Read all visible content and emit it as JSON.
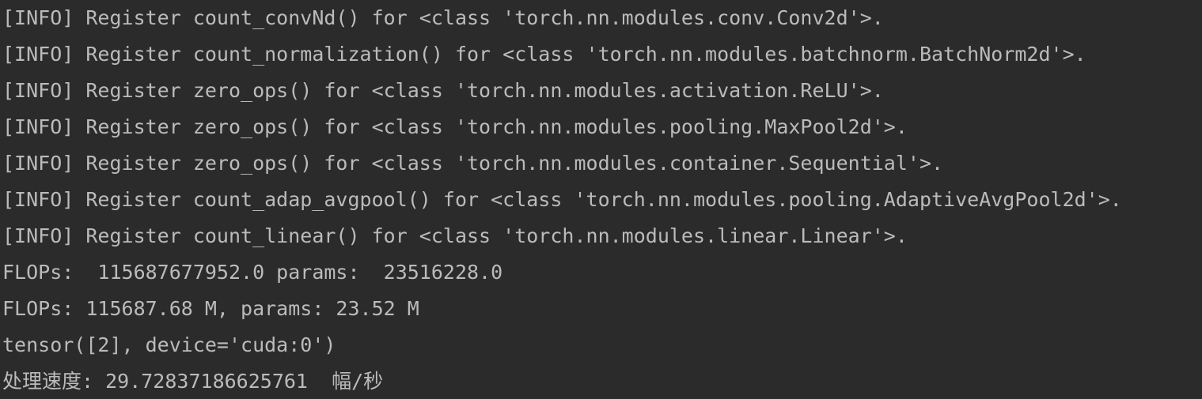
{
  "console": {
    "lines": [
      "[INFO] Register count_convNd() for <class 'torch.nn.modules.conv.Conv2d'>.",
      "[INFO] Register count_normalization() for <class 'torch.nn.modules.batchnorm.BatchNorm2d'>.",
      "[INFO] Register zero_ops() for <class 'torch.nn.modules.activation.ReLU'>.",
      "[INFO] Register zero_ops() for <class 'torch.nn.modules.pooling.MaxPool2d'>.",
      "[INFO] Register zero_ops() for <class 'torch.nn.modules.container.Sequential'>.",
      "[INFO] Register count_adap_avgpool() for <class 'torch.nn.modules.pooling.AdaptiveAvgPool2d'>.",
      "[INFO] Register count_linear() for <class 'torch.nn.modules.linear.Linear'>.",
      "FLOPs:  115687677952.0 params:  23516228.0",
      "FLOPs: 115687.68 M, params: 23.52 M",
      "tensor([2], device='cuda:0')",
      "处理速度: 29.72837186625761  幅/秒"
    ]
  },
  "colors": {
    "background": "#2b2b2b",
    "text": "#bbbbbb"
  }
}
